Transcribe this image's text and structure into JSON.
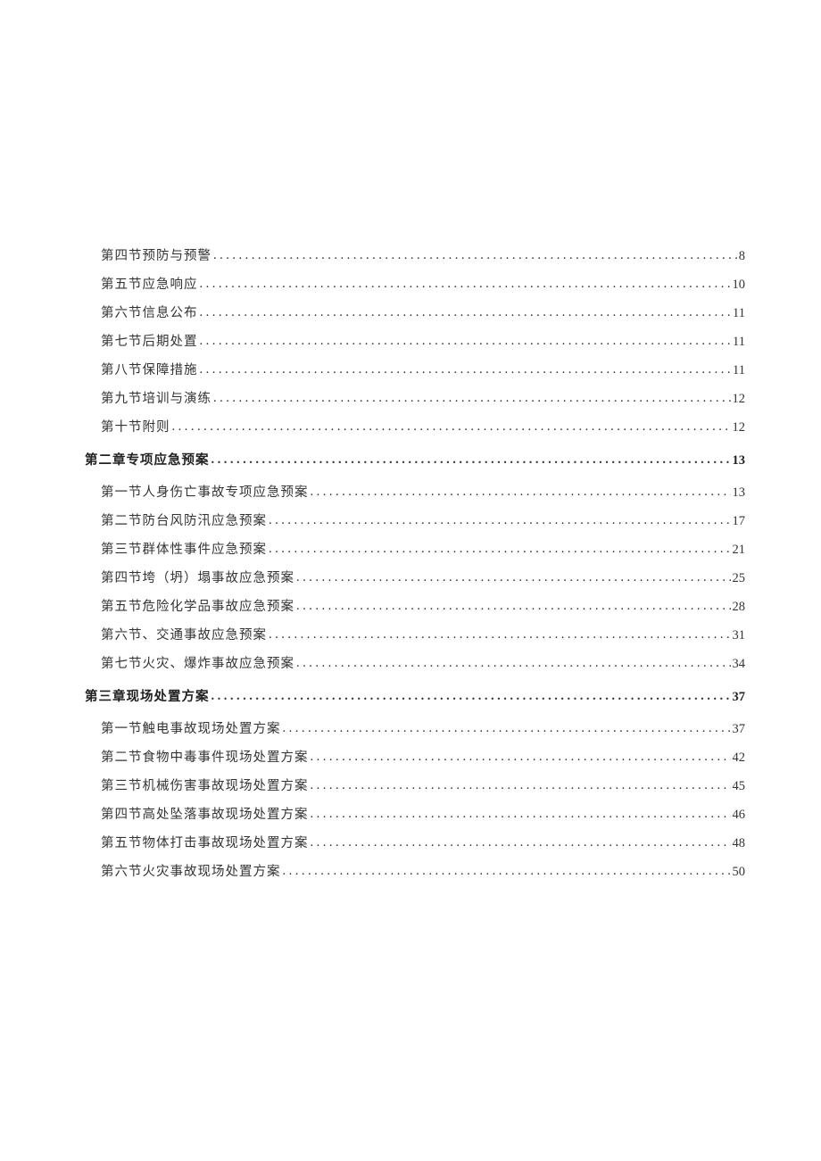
{
  "toc": [
    {
      "level": "section",
      "text": "第四节预防与预警",
      "page": "8"
    },
    {
      "level": "section",
      "text": "第五节应急响应",
      "page": "10"
    },
    {
      "level": "section",
      "text": "第六节信息公布",
      "page": "11"
    },
    {
      "level": "section",
      "text": "第七节后期处置",
      "page": "11"
    },
    {
      "level": "section",
      "text": "第八节保障措施",
      "page": "11"
    },
    {
      "level": "section",
      "text": "第九节培训与演练",
      "page": "12"
    },
    {
      "level": "section",
      "text": "第十节附则",
      "page": "12"
    },
    {
      "level": "chapter",
      "text": "第二章专项应急预案",
      "page": "13"
    },
    {
      "level": "section",
      "text": "第一节人身伤亡事故专项应急预案",
      "page": "13"
    },
    {
      "level": "section",
      "text": "第二节防台风防汛应急预案",
      "page": "17"
    },
    {
      "level": "section",
      "text": "第三节群体性事件应急预案",
      "page": "21"
    },
    {
      "level": "section",
      "text": "第四节垮（坍）塌事故应急预案",
      "page": "25"
    },
    {
      "level": "section",
      "text": "第五节危险化学品事故应急预案",
      "page": "28"
    },
    {
      "level": "section",
      "text": "第六节、交通事故应急预案",
      "page": "31"
    },
    {
      "level": "section",
      "text": "第七节火灾、爆炸事故应急预案",
      "page": "34"
    },
    {
      "level": "chapter",
      "text": "第三章现场处置方案",
      "page": "37"
    },
    {
      "level": "section",
      "text": "第一节触电事故现场处置方案",
      "page": "37"
    },
    {
      "level": "section",
      "text": "第二节食物中毒事件现场处置方案",
      "page": "42"
    },
    {
      "level": "section",
      "text": "第三节机械伤害事故现场处置方案",
      "page": "45"
    },
    {
      "level": "section",
      "text": "第四节高处坠落事故现场处置方案",
      "page": "46"
    },
    {
      "level": "section",
      "text": "第五节物体打击事故现场处置方案",
      "page": "48"
    },
    {
      "level": "section",
      "text": "第六节火灾事故现场处置方案",
      "page": "50"
    }
  ]
}
